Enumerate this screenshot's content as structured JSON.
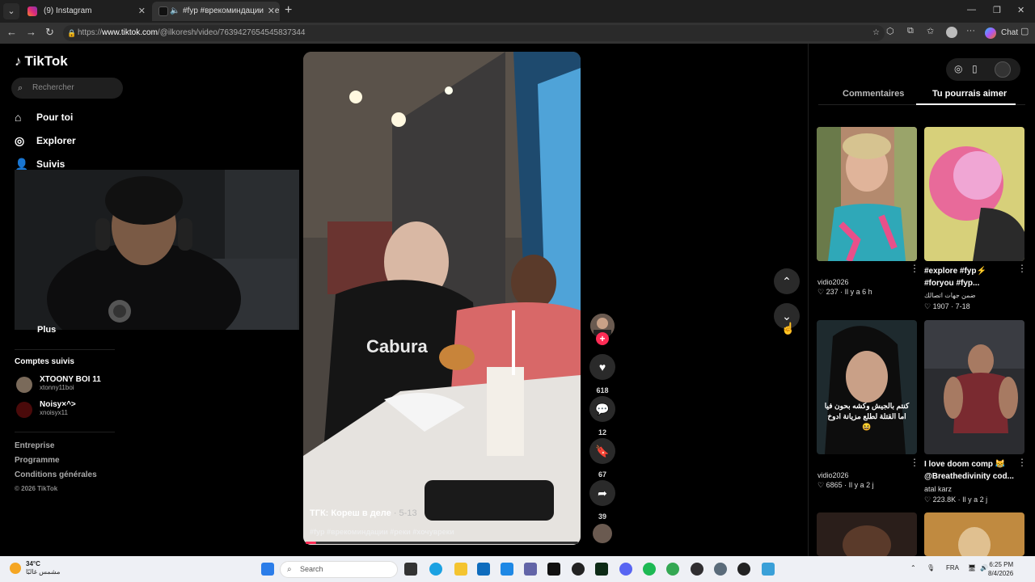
{
  "browser": {
    "tabs": [
      {
        "title": "(9) Instagram",
        "color": "#e1306c"
      },
      {
        "title": "#fyp #врекоминдации #реки",
        "color": "#111111"
      }
    ],
    "url_prefix": "https://",
    "url_host": "www.tiktok.com",
    "url_path": "/@ilkoresh/video/7639427654545837344",
    "chat_label": "Chat"
  },
  "sidebar": {
    "logo": "TikTok",
    "search_placeholder": "Rechercher",
    "nav": [
      {
        "label": "Pour toi",
        "icon": "home-icon"
      },
      {
        "label": "Explorer",
        "icon": "compass-icon"
      },
      {
        "label": "Suivis",
        "icon": "following-icon"
      }
    ],
    "more_label": "Plus",
    "followed_title": "Comptes suivis",
    "accounts": [
      {
        "name": "XTOONY BOI 11",
        "handle": "xtonny11boi"
      },
      {
        "name": "Noisy×^>",
        "handle": "xnoisyx11"
      }
    ],
    "footer_links": [
      "Entreprise",
      "Programme",
      "Conditions générales"
    ],
    "copyright": "© 2026 TikTok"
  },
  "video": {
    "caption": "ТГК: Кореш в деле",
    "date": "· 5-13",
    "hashtags": "#fyp #врекоминдации #реки #хочувреки",
    "shirt_text": "Cabura",
    "progress": 0.04,
    "likes": "618",
    "comments": "12",
    "saves": "67",
    "shares": "39"
  },
  "panel": {
    "tabs": [
      "Commentaires",
      "Tu pourrais aimer"
    ],
    "active_tab": "Tu pourrais aimer",
    "cards": [
      {
        "title": "",
        "user": "vidio2026",
        "likes": "237",
        "time": "Il y a 6 h"
      },
      {
        "title": "#explore #fyp⚡ #foryou #fyp...",
        "user": "ضمن جهات اتصالك",
        "likes": "1907",
        "time": "7-18"
      },
      {
        "title": "",
        "user": "vidio2026",
        "likes": "6865",
        "time": "Il y a 2 j",
        "overlay": "كنتم بالجيش وكشه بحون فيا اما القتلة لطلع مزيانة ادوخ 😆"
      },
      {
        "title": "I love doom comp 😹 @Breathedivinity cod...",
        "user": "atal karz",
        "likes": "223.8K",
        "time": "Il y a 2 j"
      }
    ]
  },
  "taskbar": {
    "temp": "34°C",
    "weather": "مشمس غالبًا",
    "search": "Search",
    "lang": "FRA",
    "time": "6:25 PM",
    "date": "8/4/2026"
  }
}
